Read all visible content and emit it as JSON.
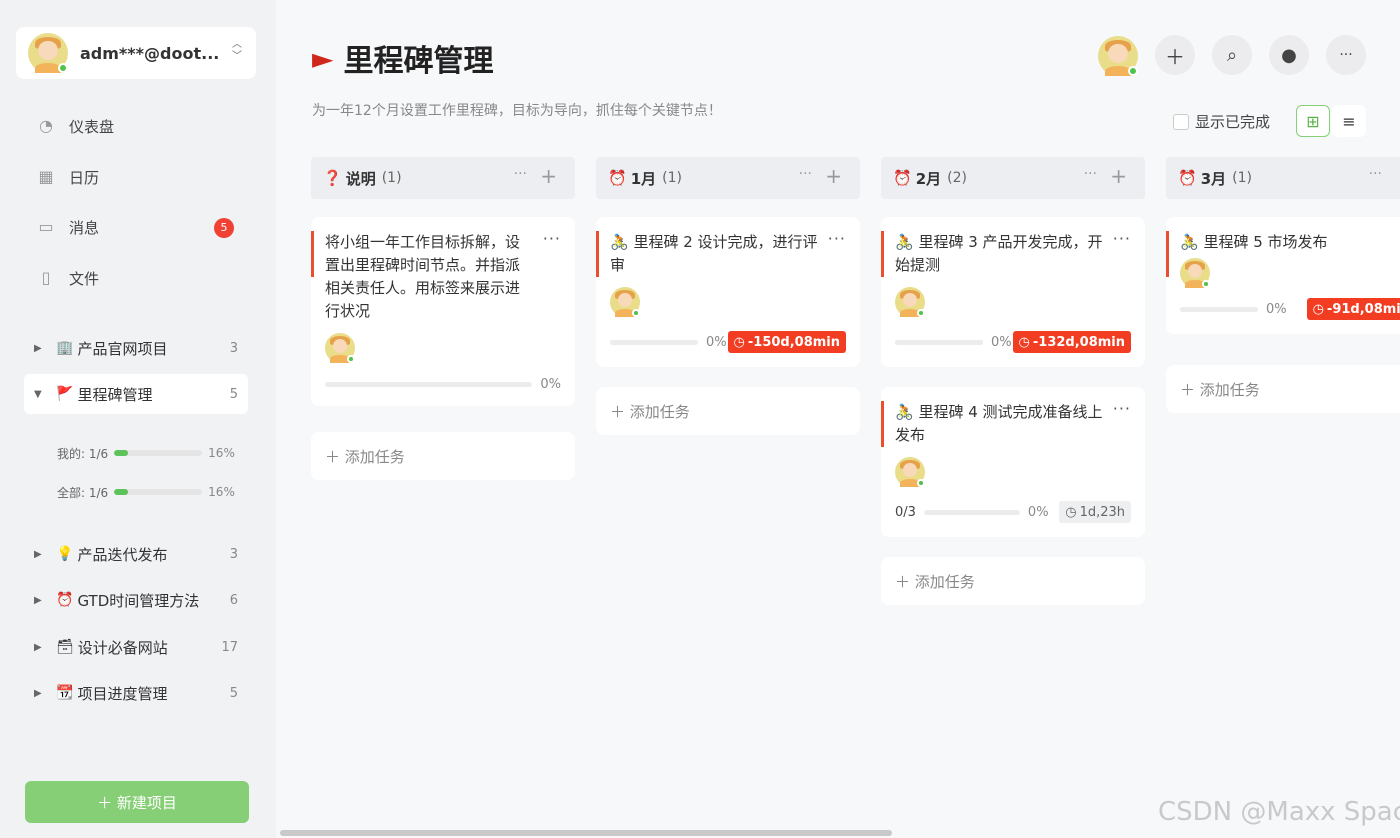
{
  "account": {
    "name": "adm***@doot...",
    "icon": "chevron-up-down-icon"
  },
  "nav": [
    {
      "label": "仪表盘",
      "icon": "dashboard-icon"
    },
    {
      "label": "日历",
      "icon": "calendar-icon"
    },
    {
      "label": "消息",
      "icon": "message-icon",
      "badge": "5"
    },
    {
      "label": "文件",
      "icon": "file-icon"
    }
  ],
  "projects": [
    {
      "icon": "🏢",
      "label": "产品官网项目",
      "count": "3",
      "expanded": false
    },
    {
      "icon": "🚩",
      "label": "里程碑管理",
      "count": "5",
      "expanded": true
    },
    {
      "icon": "💡",
      "label": "产品迭代发布",
      "count": "3",
      "expanded": false
    },
    {
      "icon": "⏰",
      "label": "GTD时间管理方法",
      "count": "6",
      "expanded": false
    },
    {
      "icon": "🗃",
      "label": "设计必备网站",
      "count": "17",
      "expanded": false
    },
    {
      "icon": "📆",
      "label": "项目进度管理",
      "count": "5",
      "expanded": false
    }
  ],
  "stats": [
    {
      "label": "我的: 1/6",
      "pct": "16%",
      "value": 0.16
    },
    {
      "label": "全部: 1/6",
      "pct": "16%",
      "value": 0.16
    }
  ],
  "new_project": "＋  新建项目",
  "page": {
    "title": "里程碑管理",
    "subtitle": "为一年12个月设置工作里程碑，目标为导向，抓住每个关键节点！",
    "show_done": "显示已完成"
  },
  "columns": [
    {
      "icon": "❓",
      "title": "说明",
      "count": "(1)",
      "cards": [
        {
          "text": "将小组一年工作目标拆解，设置出里程碑时间节点。并指派相关责任人。用标签来展示进行状况",
          "pct": "0%",
          "progress": 0,
          "due": ""
        }
      ],
      "add": "＋ 添加任务"
    },
    {
      "icon": "⏰",
      "title": "1月",
      "count": "(1)",
      "cards": [
        {
          "text": "🚴 里程碑 2 设计完成，进行评审",
          "pct": "0%",
          "progress": 0,
          "due": "-150d,08min",
          "due_type": "over"
        }
      ],
      "add": "＋ 添加任务"
    },
    {
      "icon": "⏰",
      "title": "2月",
      "count": "(2)",
      "cards": [
        {
          "text": "🚴 里程碑 3 产品开发完成，开始提测",
          "pct": "0%",
          "progress": 0,
          "due": "-132d,08min",
          "due_type": "over"
        },
        {
          "text": "🚴 里程碑 4 测试完成准备线上发布",
          "sub": "0/3",
          "pct": "0%",
          "progress": 0,
          "due": "1d,23h",
          "due_type": "ok"
        }
      ],
      "add": "＋ 添加任务"
    },
    {
      "icon": "⏰",
      "title": "3月",
      "count": "(1)",
      "cards": [
        {
          "text": "🚴 里程碑 5 市场发布",
          "pct": "0%",
          "progress": 0,
          "due": "-91d,08min",
          "due_type": "over"
        }
      ],
      "add": "＋ 添加任务"
    }
  ],
  "watermark": "CSDN @Maxx Space"
}
